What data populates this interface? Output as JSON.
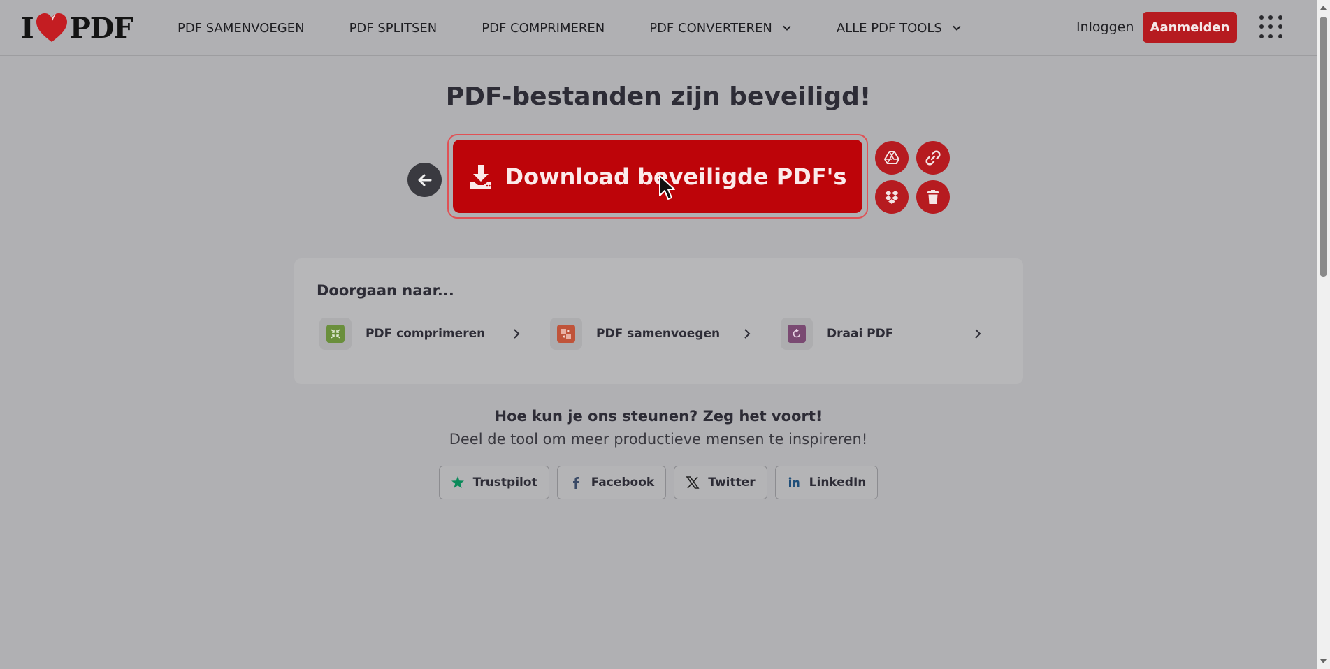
{
  "header": {
    "logo_left": "I",
    "logo_right": "PDF",
    "nav": [
      {
        "label": "PDF SAMENVOEGEN",
        "has_dropdown": false
      },
      {
        "label": "PDF SPLITSEN",
        "has_dropdown": false
      },
      {
        "label": "PDF COMPRIMEREN",
        "has_dropdown": false
      },
      {
        "label": "PDF CONVERTEREN",
        "has_dropdown": true
      },
      {
        "label": "ALLE PDF TOOLS",
        "has_dropdown": true
      }
    ],
    "login_label": "Inloggen",
    "signup_label": "Aanmelden",
    "menu_icon": "apps-grid-icon"
  },
  "main": {
    "title": "PDF-bestanden zijn beveiligd!",
    "download_label": "Download beveiligde PDF's",
    "side_actions": [
      {
        "name": "google-drive",
        "icon": "google-drive-icon"
      },
      {
        "name": "copy-link",
        "icon": "link-icon"
      },
      {
        "name": "dropbox",
        "icon": "dropbox-icon"
      },
      {
        "name": "delete",
        "icon": "trash-icon"
      }
    ]
  },
  "continue": {
    "title": "Doorgaan naar...",
    "tools": [
      {
        "label": "PDF comprimeren",
        "color": "#6a8f3c"
      },
      {
        "label": "PDF samenvoegen",
        "color": "#c0543a"
      },
      {
        "label": "Draai PDF",
        "color": "#7a4a72"
      }
    ]
  },
  "share": {
    "question": "Hoe kun je ons steunen? Zeg het voort!",
    "subtitle": "Deel de tool om meer productieve mensen te inspireren!",
    "buttons": [
      {
        "label": "Trustpilot",
        "icon": "trustpilot-star-icon"
      },
      {
        "label": "Facebook",
        "icon": "facebook-icon"
      },
      {
        "label": "Twitter",
        "icon": "x-twitter-icon"
      },
      {
        "label": "LinkedIn",
        "icon": "linkedin-icon"
      }
    ]
  },
  "colors": {
    "brand_red": "#b61b20",
    "download_red": "#bd0409",
    "overlay_bg": "#b0b0b3"
  }
}
